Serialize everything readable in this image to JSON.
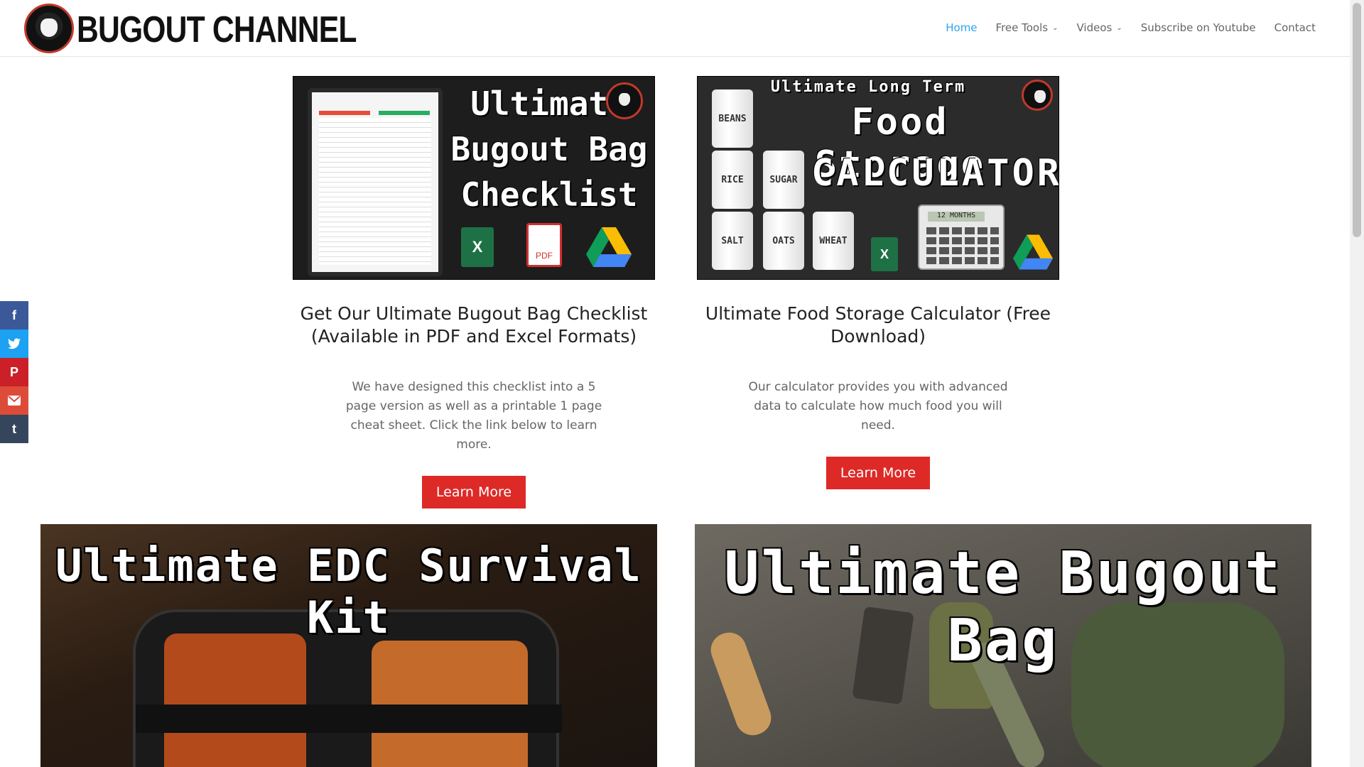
{
  "header": {
    "logo_text": "BUGOUT CHANNEL",
    "nav": [
      {
        "label": "Home",
        "active": true
      },
      {
        "label": "Free Tools",
        "dropdown": true
      },
      {
        "label": "Videos",
        "dropdown": true
      },
      {
        "label": "Subscribe on Youtube"
      },
      {
        "label": "Contact"
      }
    ]
  },
  "social": [
    "facebook-icon",
    "twitter-icon",
    "pinterest-icon",
    "email-icon",
    "tumblr-icon"
  ],
  "cards": [
    {
      "image": {
        "title_lines": [
          "Ultimate",
          "Bugout Bag",
          "Checklist"
        ],
        "icons": [
          "excel-icon",
          "pdf-icon",
          "google-drive-icon"
        ],
        "pdf_label": "PDF",
        "excel_label": "X"
      },
      "title": "Get Our Ultimate Bugout Bag Checklist (Available in PDF and Excel Formats)",
      "text": "We have designed this checklist into a 5 page version as well as a printable 1 page cheat sheet. Click the link below to learn more.",
      "button": "Learn More"
    },
    {
      "image": {
        "top_line": "Ultimate Long Term",
        "line2": "Food Storage",
        "line3": "CALCULATOR",
        "jars": [
          "BEANS",
          "RICE",
          "SUGAR",
          "SALT",
          "OATS",
          "WHEAT"
        ],
        "calc_screen": "12 MONTHS",
        "excel_label": "X"
      },
      "title": "Ultimate Food Storage Calculator (Free Download)",
      "text": "Our calculator provides you with advanced data to calculate how much food you will need.",
      "button": "Learn More"
    }
  ],
  "banners": [
    {
      "title": "Ultimate EDC Survival Kit"
    },
    {
      "title": "Ultimate Bugout Bag"
    }
  ],
  "colors": {
    "accent": "#2ea3f2",
    "button": "#dd2a27"
  }
}
